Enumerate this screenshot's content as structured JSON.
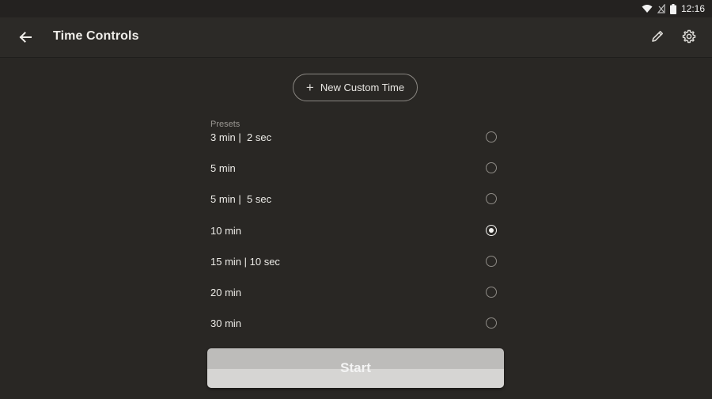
{
  "status_bar": {
    "time": "12:16",
    "icons": [
      "wifi-icon",
      "no-signal-icon",
      "battery-icon"
    ]
  },
  "app_bar": {
    "title": "Time Controls",
    "icons": [
      "back-arrow-icon",
      "pencil-icon",
      "gear-icon"
    ]
  },
  "new_custom_time": {
    "label": "New Custom Time",
    "icon": "plus-icon"
  },
  "presets": {
    "heading": "Presets",
    "items": [
      {
        "label": "3 min |  2 sec",
        "selected": false
      },
      {
        "label": "5 min",
        "selected": false
      },
      {
        "label": "5 min |  5 sec",
        "selected": false
      },
      {
        "label": "10 min",
        "selected": true
      },
      {
        "label": "15 min | 10 sec",
        "selected": false
      },
      {
        "label": "20 min",
        "selected": false
      },
      {
        "label": "30 min",
        "selected": false
      }
    ]
  },
  "start_button": {
    "label": "Start"
  },
  "colors": {
    "background": "#292724",
    "app_bar": "#2c2a27",
    "start_button": "#bdbcba",
    "radio_selected": "#f2f1ee"
  }
}
